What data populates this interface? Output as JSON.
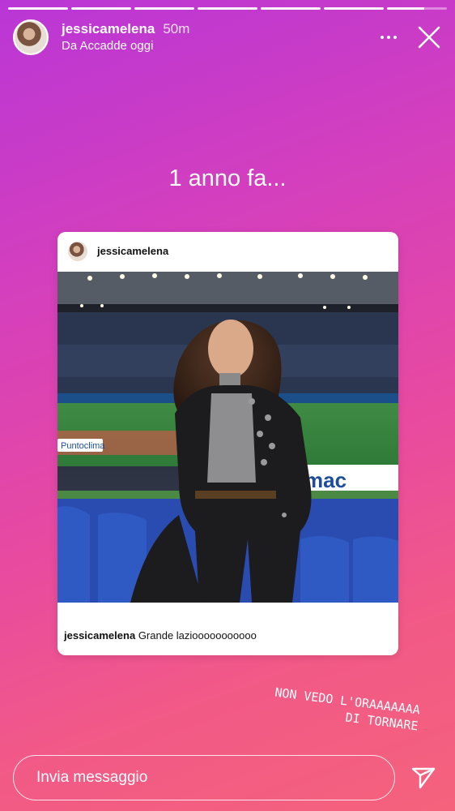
{
  "story": {
    "segments": 7,
    "username": "jessicamelena",
    "time": "50m",
    "subtitle": "Da Accadde oggi",
    "more_icon": "more-horizontal-icon",
    "close_icon": "close-icon"
  },
  "headline": "1 anno fa...",
  "post": {
    "username": "jessicamelena",
    "caption_user": "jessicamelena",
    "caption_text": "Grande laziooooooooooo",
    "stadium_banners": [
      "Puntoclima",
      "mac"
    ]
  },
  "sticker": {
    "line1": "NON VEDO L'ORAAAAAAA",
    "line2": "DI TORNARE"
  },
  "footer": {
    "message_placeholder": "Invia messaggio",
    "send_icon": "send-icon"
  },
  "colors": {
    "gradient_top": "#b936d6",
    "gradient_bottom": "#f4627c",
    "text": "#ffffff",
    "card": "#ffffff"
  }
}
